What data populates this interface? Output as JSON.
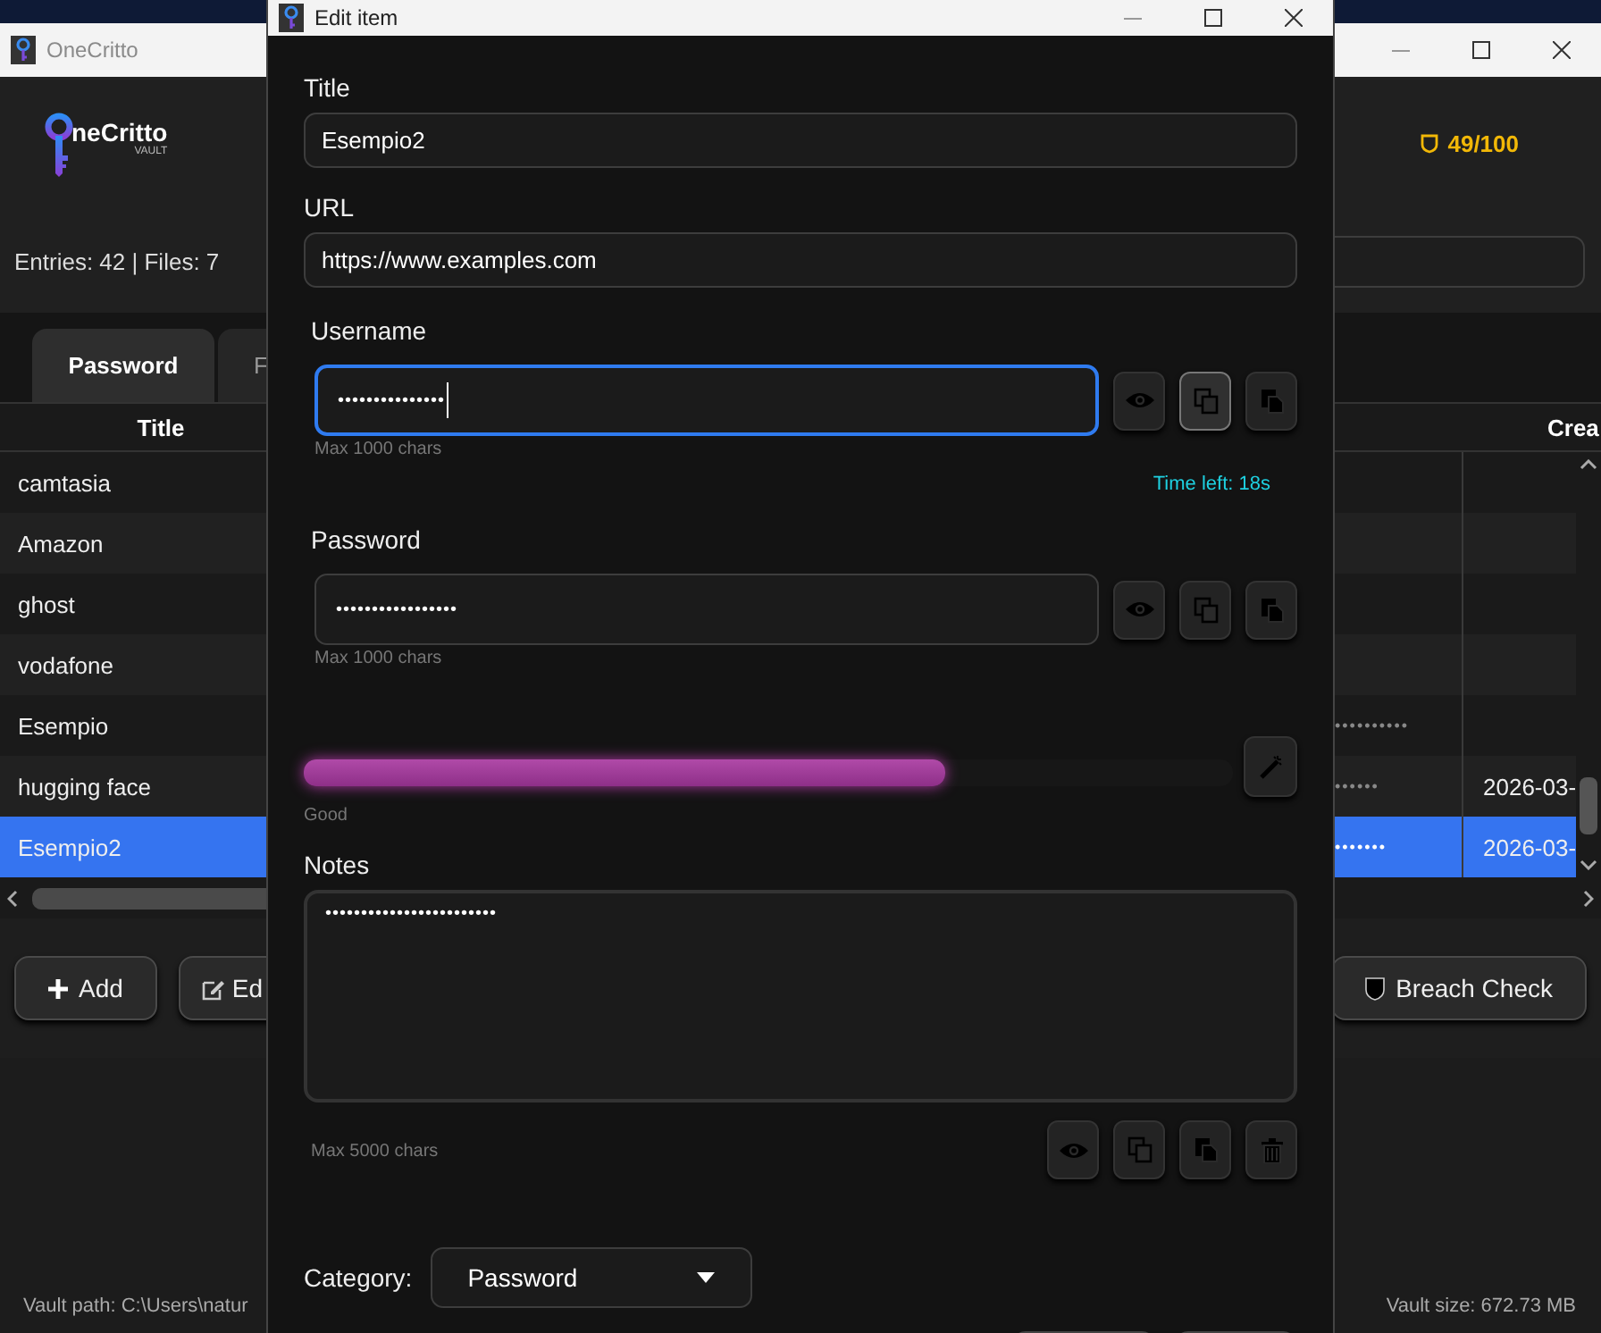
{
  "main_window": {
    "title": "OneCritto",
    "brand": "neCritto",
    "brand_tagline": "VAULT",
    "security_score": "49/100",
    "stats": "Entries: 42 | Files: 7",
    "tabs": [
      {
        "label": "Password",
        "selected": true
      },
      {
        "label": "F",
        "selected": false
      }
    ],
    "table": {
      "columns": [
        "Title",
        "Crea"
      ],
      "rows": [
        {
          "title": "camtasia",
          "selected": false
        },
        {
          "title": "Amazon",
          "selected": false
        },
        {
          "title": "ghost",
          "selected": false
        },
        {
          "title": "vodafone",
          "selected": false
        },
        {
          "title": "Esempio",
          "column_3": "••••••••••",
          "selected": false
        },
        {
          "title": "hugging face",
          "column_3": "••••••",
          "created": "2026-03-",
          "selected": false
        },
        {
          "title": "Esempio2",
          "column_3": "•••••••",
          "created": "2026-03-",
          "selected": true
        }
      ]
    },
    "add_button": "Add",
    "edit_button": "Ed",
    "breach_button": "Breach Check",
    "status_bar": {
      "vault_path": "Vault path: C:\\Users\\natur",
      "vault_size": "Vault size: 672.73 MB"
    }
  },
  "dialog": {
    "title": "Edit item",
    "fields": [
      {
        "label": "Title",
        "value": "Esempio2"
      },
      {
        "label": "URL",
        "value": "https://www.examples.com"
      }
    ],
    "username": {
      "label": "Username",
      "value": "•••••••••••••••",
      "focused": true,
      "hint": "Max 1000 chars",
      "actions": [
        {
          "kind": "reveal",
          "active": false
        },
        {
          "kind": "copy",
          "active": true
        },
        {
          "kind": "paste",
          "active": false
        }
      ]
    },
    "timer": "Time left: 18s",
    "password": {
      "label": "Password",
      "value": "•••••••••••••••••",
      "focused": false,
      "hint": "Max 1000 chars",
      "actions": [
        {
          "kind": "reveal",
          "active": false
        },
        {
          "kind": "copy",
          "active": false
        },
        {
          "kind": "paste",
          "active": false
        }
      ]
    },
    "strength": {
      "level": 0.69,
      "label": "Good"
    },
    "notes": {
      "label": "Notes",
      "value": "••••••••••••••••••••••••",
      "hint": "Max 5000 chars",
      "actions": [
        {
          "kind": "reveal",
          "active": false
        },
        {
          "kind": "copy",
          "active": false
        },
        {
          "kind": "paste",
          "active": false
        },
        {
          "kind": "delete",
          "active": false
        }
      ]
    },
    "category": {
      "label": "Category:",
      "value": "Password"
    }
  }
}
